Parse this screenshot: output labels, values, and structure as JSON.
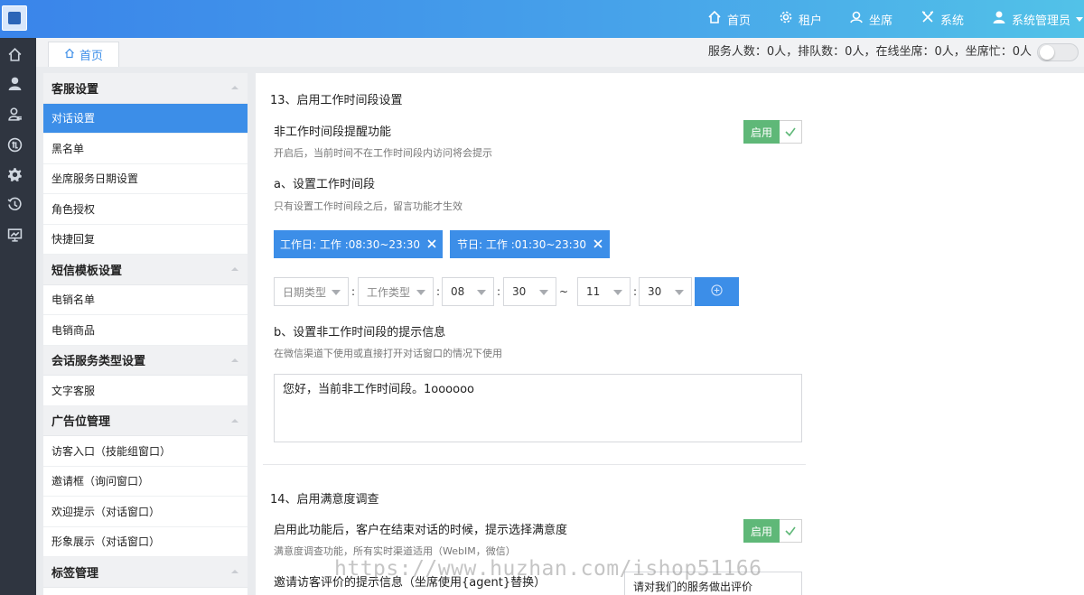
{
  "topnav": [
    {
      "label": "首页",
      "icon": "home-icon"
    },
    {
      "label": "租户",
      "icon": "gear-icon"
    },
    {
      "label": "坐席",
      "icon": "agent-icon"
    },
    {
      "label": "系统",
      "icon": "tools-icon"
    },
    {
      "label": "系统管理员",
      "icon": "user-icon"
    }
  ],
  "leftbar_icons": [
    "home-icon",
    "user-icon",
    "contacts-icon",
    "knowledge-icon",
    "settings-icon",
    "history-icon",
    "monitor-icon"
  ],
  "tab": {
    "label": "首页"
  },
  "status": {
    "text": "服务人数：0人，排队数：0人，在线坐席：0人，坐席忙：0人"
  },
  "sidebar": {
    "sections": [
      {
        "title": "客服设置",
        "items": [
          "对话设置",
          "黑名单",
          "坐席服务日期设置",
          "角色授权",
          "快捷回复"
        ]
      },
      {
        "title": "短信模板设置",
        "items": [
          "电销名单",
          "电销商品"
        ]
      },
      {
        "title": "会话服务类型设置",
        "items": [
          "文字客服"
        ]
      },
      {
        "title": "广告位管理",
        "items": [
          "访客入口（技能组窗口）",
          "邀请框（询问窗口）",
          "欢迎提示（对话窗口）",
          "形象展示（对话窗口）"
        ]
      },
      {
        "title": "标签管理",
        "items": []
      }
    ],
    "active_item": "对话设置"
  },
  "settings": {
    "s13_title": "13、启用工作时间段设置",
    "s13_row_title": "非工作时间段提醒功能",
    "s13_row_desc": "开启后，当前时间不在工作时间段内访问将会提示",
    "enable_label": "启用",
    "a_title": "a、设置工作时间段",
    "a_desc": "只有设置工作时间段之后，留言功能才生效",
    "chips": [
      "工作日: 工作 :08:30~23:30",
      "节日: 工作 :01:30~23:30"
    ],
    "form": {
      "date_type_placeholder": "日期类型",
      "work_type_placeholder": "工作类型",
      "start_hour": "08",
      "start_min": "30",
      "end_hour": "11",
      "end_min": "30",
      "colon": ":",
      "tilde": "~"
    },
    "b_title": "b、设置非工作时间段的提示信息",
    "b_desc": "在微信渠道下使用或直接打开对话窗口的情况下使用",
    "b_message": "您好，当前非工作时间段。1oooooo",
    "s14_title": "14、启用满意度调查",
    "s14_row_title": "启用此功能后，客户在结束对话的时候，提示选择满意度",
    "s14_row_desc": "满意度调查功能，所有实时渠道适用（WebIM，微信）",
    "s14_invite_label": "邀请访客评价的提示信息（坐席使用{agent}替换）",
    "s14_invite_value": "请对我们的服务做出评价"
  },
  "watermark": "https://www.huzhan.com/ishop51166"
}
